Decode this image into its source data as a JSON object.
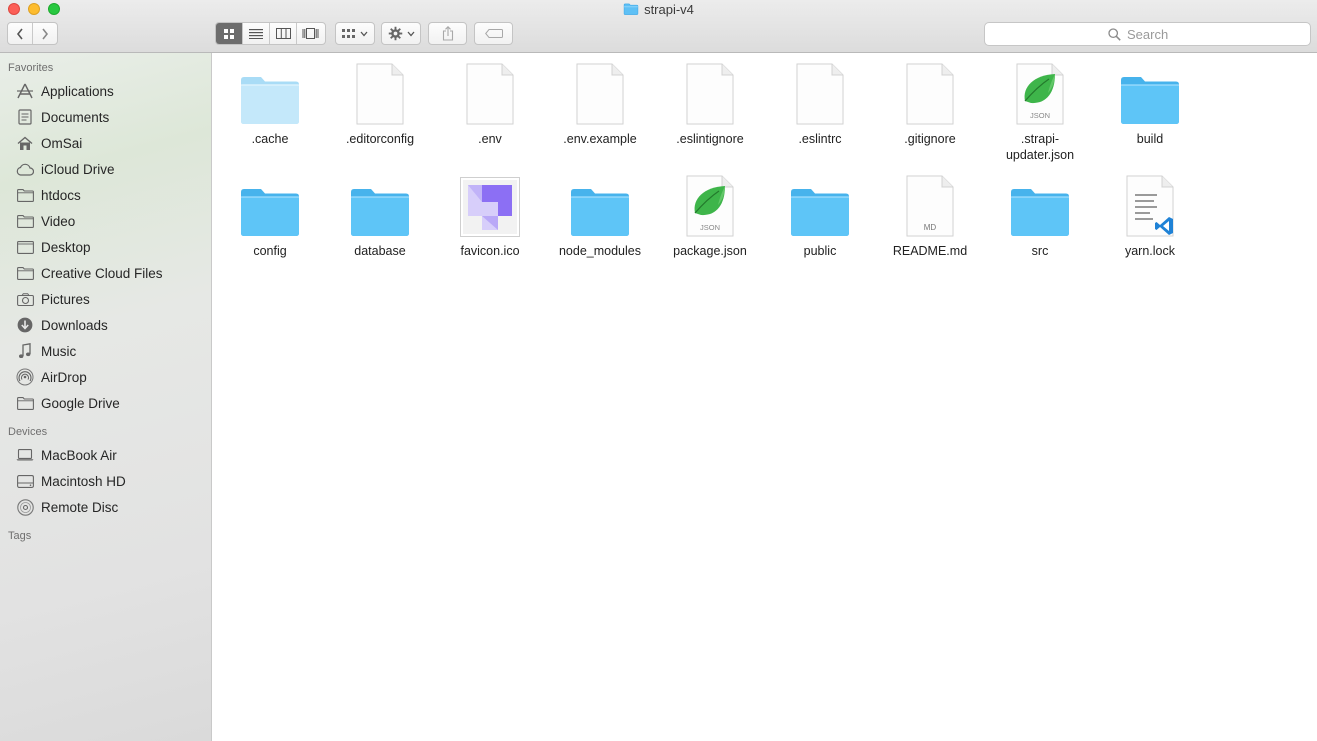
{
  "window": {
    "title": "strapi-v4"
  },
  "toolbar": {
    "back_icon": "chevron-left-icon",
    "forward_icon": "chevron-right-icon",
    "view_modes": [
      "icon-view",
      "list-view",
      "column-view",
      "cover-flow-view"
    ],
    "active_view": "icon-view"
  },
  "search": {
    "placeholder": "Search"
  },
  "sidebar": {
    "favorites_header": "Favorites",
    "favorites": [
      {
        "label": "Applications",
        "icon": "applications-icon"
      },
      {
        "label": "Documents",
        "icon": "documents-icon"
      },
      {
        "label": "OmSai",
        "icon": "home-icon"
      },
      {
        "label": "iCloud Drive",
        "icon": "cloud-icon"
      },
      {
        "label": "htdocs",
        "icon": "folder-icon"
      },
      {
        "label": "Video",
        "icon": "folder-icon"
      },
      {
        "label": "Desktop",
        "icon": "desktop-icon"
      },
      {
        "label": "Creative Cloud Files",
        "icon": "folder-icon"
      },
      {
        "label": "Pictures",
        "icon": "camera-icon"
      },
      {
        "label": "Downloads",
        "icon": "download-icon"
      },
      {
        "label": "Music",
        "icon": "music-note-icon"
      },
      {
        "label": "AirDrop",
        "icon": "airdrop-icon"
      },
      {
        "label": "Google Drive",
        "icon": "folder-icon"
      }
    ],
    "devices_header": "Devices",
    "devices": [
      {
        "label": "MacBook Air",
        "icon": "laptop-icon"
      },
      {
        "label": "Macintosh HD",
        "icon": "hard-drive-icon"
      },
      {
        "label": "Remote Disc",
        "icon": "disc-icon"
      }
    ],
    "tags_header": "Tags"
  },
  "files": [
    {
      "name": ".cache",
      "type": "folder-light"
    },
    {
      "name": ".editorconfig",
      "type": "blank"
    },
    {
      "name": ".env",
      "type": "blank"
    },
    {
      "name": ".env.example",
      "type": "blank"
    },
    {
      "name": ".eslintignore",
      "type": "blank"
    },
    {
      "name": ".eslintrc",
      "type": "blank"
    },
    {
      "name": ".gitignore",
      "type": "blank"
    },
    {
      "name": ".strapi-updater.json",
      "type": "json",
      "badge": "JSON"
    },
    {
      "name": "build",
      "type": "folder"
    },
    {
      "name": "config",
      "type": "folder"
    },
    {
      "name": "database",
      "type": "folder"
    },
    {
      "name": "favicon.ico",
      "type": "ico"
    },
    {
      "name": "node_modules",
      "type": "folder"
    },
    {
      "name": "package.json",
      "type": "json",
      "badge": "JSON"
    },
    {
      "name": "public",
      "type": "folder"
    },
    {
      "name": "README.md",
      "type": "md",
      "badge": "MD"
    },
    {
      "name": "src",
      "type": "folder"
    },
    {
      "name": "yarn.lock",
      "type": "vscode"
    }
  ]
}
